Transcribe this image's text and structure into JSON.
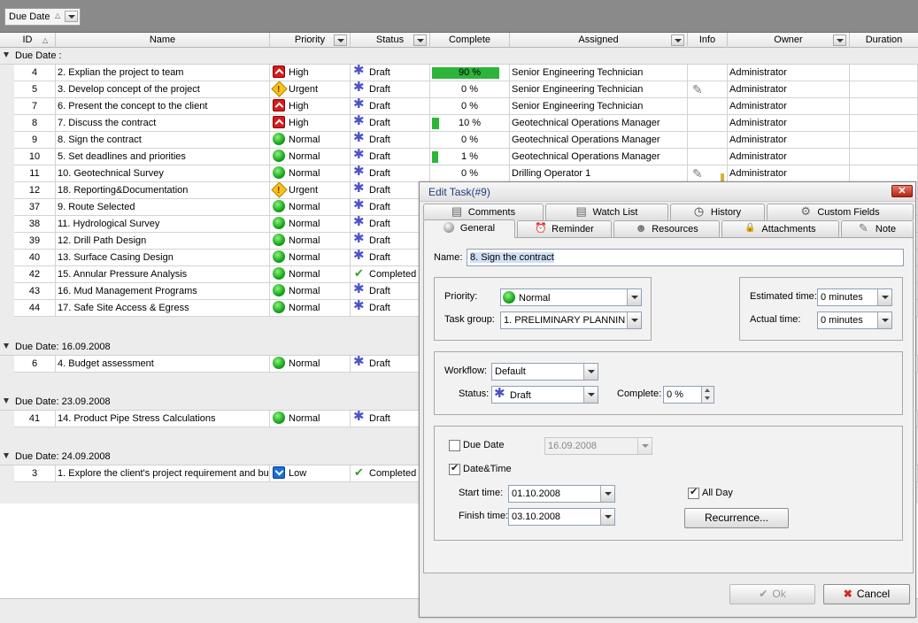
{
  "group_panel": {
    "chip_label": "Due Date"
  },
  "columns": {
    "id": "ID",
    "name": "Name",
    "priority": "Priority",
    "status": "Status",
    "complete": "Complete",
    "assigned": "Assigned",
    "info": "Info",
    "owner": "Owner",
    "duration": "Duration"
  },
  "groups": [
    {
      "label": "Due Date :"
    },
    {
      "label": "Due Date: 16.09.2008"
    },
    {
      "label": "Due Date: 23.09.2008"
    },
    {
      "label": "Due Date: 24.09.2008"
    }
  ],
  "rows": [
    {
      "id": "4",
      "name": "2. Explian the project to team",
      "priority": "High",
      "priority_icon": "high",
      "status": "Draft",
      "status_icon": "draft",
      "complete": "90 %",
      "complete_fraction": 0.9,
      "assigned": "Senior Engineering Technician",
      "info": "",
      "owner": "Administrator"
    },
    {
      "id": "5",
      "name": "3. Develop concept of the project",
      "priority": "Urgent",
      "priority_icon": "urgent",
      "status": "Draft",
      "status_icon": "draft",
      "complete": "0 %",
      "complete_fraction": 0,
      "assigned": "Senior Engineering Technician",
      "info": "note-icon",
      "owner": "Administrator"
    },
    {
      "id": "7",
      "name": "6. Present the concept to the client",
      "priority": "High",
      "priority_icon": "high",
      "status": "Draft",
      "status_icon": "draft",
      "complete": "0 %",
      "complete_fraction": 0,
      "assigned": "Senior Engineering Technician",
      "info": "",
      "owner": "Administrator"
    },
    {
      "id": "8",
      "name": "7. Discuss the contract",
      "priority": "High",
      "priority_icon": "high",
      "status": "Draft",
      "status_icon": "draft",
      "complete": "10 %",
      "complete_fraction": 0.1,
      "assigned": "Geotechnical Operations Manager",
      "info": "",
      "owner": "Administrator"
    },
    {
      "id": "9",
      "name": "8. Sign the contract",
      "priority": "Normal",
      "priority_icon": "normal",
      "status": "Draft",
      "status_icon": "draft",
      "complete": "0 %",
      "complete_fraction": 0,
      "assigned": "Geotechnical Operations Manager",
      "info": "",
      "owner": "Administrator"
    },
    {
      "id": "10",
      "name": "5. Set deadlines and priorities",
      "priority": "Normal",
      "priority_icon": "normal",
      "status": "Draft",
      "status_icon": "draft",
      "complete": "1 %",
      "complete_fraction": 0.01,
      "assigned": "Geotechnical Operations Manager",
      "info": "",
      "owner": "Administrator"
    },
    {
      "id": "11",
      "name": "10. Geotechnical Survey",
      "priority": "Normal",
      "priority_icon": "normal",
      "status": "Draft",
      "status_icon": "draft",
      "complete": "0 %",
      "complete_fraction": 0,
      "assigned": "Drilling Operator 1",
      "info": "note-icon",
      "owner": "Administrator"
    },
    {
      "id": "12",
      "name": "18. Reporting&Documentation",
      "priority": "Urgent",
      "priority_icon": "urgent",
      "status": "Draft",
      "status_icon": "draft"
    },
    {
      "id": "37",
      "name": "9. Route Selected",
      "priority": "Normal",
      "priority_icon": "normal",
      "status": "Draft",
      "status_icon": "draft"
    },
    {
      "id": "38",
      "name": "11. Hydrological Survey",
      "priority": "Normal",
      "priority_icon": "normal",
      "status": "Draft",
      "status_icon": "draft"
    },
    {
      "id": "39",
      "name": "12. Drill Path Design",
      "priority": "Normal",
      "priority_icon": "normal",
      "status": "Draft",
      "status_icon": "draft"
    },
    {
      "id": "40",
      "name": "13. Surface Casing Design",
      "priority": "Normal",
      "priority_icon": "normal",
      "status": "Draft",
      "status_icon": "draft"
    },
    {
      "id": "42",
      "name": "15. Annular Pressure Analysis",
      "priority": "Normal",
      "priority_icon": "normal",
      "status": "Completed",
      "status_icon": "completed"
    },
    {
      "id": "43",
      "name": "16. Mud Management Programs",
      "priority": "Normal",
      "priority_icon": "normal",
      "status": "Draft",
      "status_icon": "draft"
    },
    {
      "id": "44",
      "name": "17. Safe Site Access & Egress",
      "priority": "Normal",
      "priority_icon": "normal",
      "status": "Draft",
      "status_icon": "draft"
    },
    {
      "id": "6",
      "name": "4. Budget assessment",
      "priority": "Normal",
      "priority_icon": "normal",
      "status": "Draft",
      "status_icon": "draft"
    },
    {
      "id": "41",
      "name": "14. Product Pipe Stress Calculations",
      "priority": "Normal",
      "priority_icon": "normal",
      "status": "Draft",
      "status_icon": "draft"
    },
    {
      "id": "3",
      "name": "1. Explore the client's project requirement and bu",
      "priority": "Low",
      "priority_icon": "low",
      "status": "Completed",
      "status_icon": "completed"
    }
  ],
  "dialog": {
    "title": "Edit Task(#9)",
    "tabs_top": [
      "Comments",
      "Watch List",
      "History",
      "Custom Fields"
    ],
    "tabs_bottom": [
      "General",
      "Reminder",
      "Resources",
      "Attachments",
      "Note"
    ],
    "name_label": "Name:",
    "name_value": "8. Sign the contract",
    "priority_label": "Priority:",
    "priority_value": "Normal",
    "task_group_label": "Task group:",
    "task_group_value": "1. PRELIMINARY PLANNIN",
    "estimated_label": "Estimated time:",
    "estimated_value": "0 minutes",
    "actual_label": "Actual time:",
    "actual_value": "0 minutes",
    "workflow_label": "Workflow:",
    "workflow_value": "Default",
    "status_label": "Status:",
    "status_value": "Draft",
    "complete_label": "Complete:",
    "complete_value": "0 %",
    "due_date_label": "Due Date",
    "due_date_value": "16.09.2008",
    "due_date_checked": false,
    "datetime_label": "Date&Time",
    "datetime_checked": true,
    "start_label": "Start time:",
    "start_value": "01.10.2008",
    "finish_label": "Finish time:",
    "finish_value": "03.10.2008",
    "allday_label": "All Day",
    "allday_checked": true,
    "recurrence_label": "Recurrence...",
    "ok_label": "Ok",
    "cancel_label": "Cancel"
  },
  "colors": {
    "accent": "#203d78",
    "progress": "#2db43a",
    "cancel_icon": "#d42a1a"
  }
}
